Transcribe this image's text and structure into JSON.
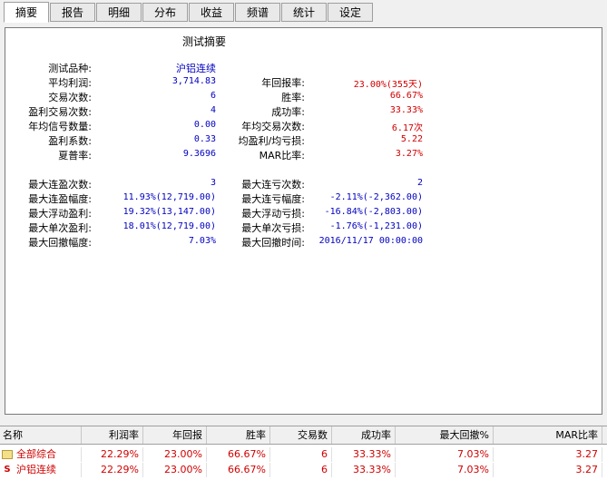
{
  "tabs": [
    "摘要",
    "报告",
    "明细",
    "分布",
    "收益",
    "频谱",
    "统计",
    "设定"
  ],
  "panel_title": "测试摘要",
  "summary_left": [
    {
      "label": "测试品种:",
      "value": "沪铝连续",
      "color": "blue"
    },
    {
      "label": "平均利润:",
      "value": "3,714.83",
      "color": "blue"
    },
    {
      "label": "交易次数:",
      "value": "6",
      "color": "blue"
    },
    {
      "label": "盈利交易次数:",
      "value": "4",
      "color": "blue"
    },
    {
      "label": "年均信号数量:",
      "value": "0.00",
      "color": "blue"
    },
    {
      "label": "盈利系数:",
      "value": "0.33",
      "color": "blue"
    },
    {
      "label": "夏普率:",
      "value": "9.3696",
      "color": "blue"
    }
  ],
  "summary_right": [
    {
      "label": "",
      "value": ""
    },
    {
      "label": "年回报率:",
      "value": "23.00%(355天)",
      "color": "red"
    },
    {
      "label": "胜率:",
      "value": "66.67%",
      "color": "red"
    },
    {
      "label": "成功率:",
      "value": "33.33%",
      "color": "red"
    },
    {
      "label": "年均交易次数:",
      "value": "6.17次",
      "color": "red"
    },
    {
      "label": "均盈利/均亏损:",
      "value": "5.22",
      "color": "red"
    },
    {
      "label": "MAR比率:",
      "value": "3.27%",
      "color": "red"
    }
  ],
  "extremes_left": [
    {
      "label": "最大连盈次数:",
      "value": "3"
    },
    {
      "label": "最大连盈幅度:",
      "value": "11.93%(12,719.00)"
    },
    {
      "label": "最大浮动盈利:",
      "value": "19.32%(13,147.00)"
    },
    {
      "label": "最大单次盈利:",
      "value": "18.01%(12,719.00)"
    },
    {
      "label": "最大回撤幅度:",
      "value": "7.03%"
    }
  ],
  "extremes_right": [
    {
      "label": "最大连亏次数:",
      "value": "2"
    },
    {
      "label": "最大连亏幅度:",
      "value": "-2.11%(-2,362.00)"
    },
    {
      "label": "最大浮动亏损:",
      "value": "-16.84%(-2,803.00)"
    },
    {
      "label": "最大单次亏损:",
      "value": "-1.76%(-1,231.00)"
    },
    {
      "label": "最大回撤时间:",
      "value": "2016/11/17 00:00:00"
    }
  ],
  "table": {
    "headers": [
      "名称",
      "利润率",
      "年回报",
      "胜率",
      "交易数",
      "成功率",
      "最大回撤%",
      "MAR比率"
    ],
    "rows": [
      {
        "icon": "folder-icon",
        "cells": [
          "全部综合",
          "22.29%",
          "23.00%",
          "66.67%",
          "6",
          "33.33%",
          "7.03%",
          "3.27"
        ]
      },
      {
        "icon": "s-icon",
        "icon_text": "S",
        "cells": [
          "沪铝连续",
          "22.29%",
          "23.00%",
          "66.67%",
          "6",
          "33.33%",
          "7.03%",
          "3.27"
        ]
      }
    ]
  },
  "colors": {
    "blue": "#0000c0",
    "red": "#d00000"
  }
}
